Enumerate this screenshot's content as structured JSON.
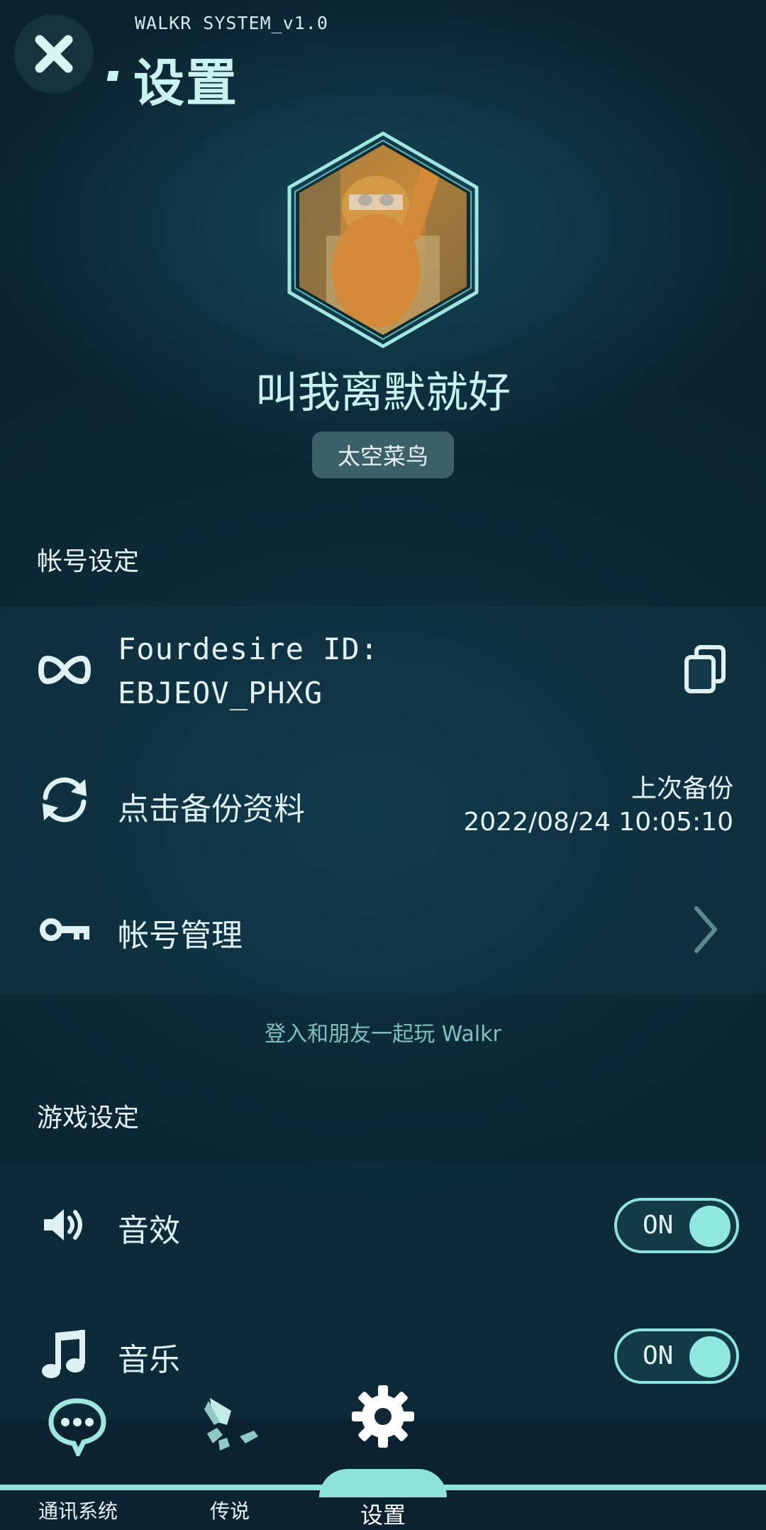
{
  "header": {
    "system_label": "WALKR SYSTEM_v1.0",
    "title": "设置"
  },
  "profile": {
    "username": "叫我离默就好",
    "rank": "太空菜鸟"
  },
  "account_section": {
    "header": "帐号设定",
    "id_label": "Fourdesire ID:",
    "id_value": "EBJEOV_PHXG",
    "backup_label": "点击备份资料",
    "last_backup_label": "上次备份",
    "last_backup_time": "2022/08/24 10:05:10",
    "manage_label": "帐号管理",
    "login_hint": "登入和朋友一起玩 Walkr"
  },
  "game_section": {
    "header": "游戏设定",
    "items": [
      {
        "label": "音效",
        "toggle": "ON",
        "icon": "speaker-icon"
      },
      {
        "label": "音乐",
        "toggle": "ON",
        "icon": "music-note-icon"
      }
    ]
  },
  "bottom_nav": {
    "items": [
      {
        "label": "通讯系统",
        "icon": "chat-bubble-icon"
      },
      {
        "label": "传说",
        "icon": "rocket-icon"
      },
      {
        "label": "设置",
        "icon": "gear-icon",
        "active": true
      }
    ]
  },
  "colors": {
    "accent": "#8fe3dd",
    "background": "#0f2a36",
    "title": "#c9f3f1"
  }
}
